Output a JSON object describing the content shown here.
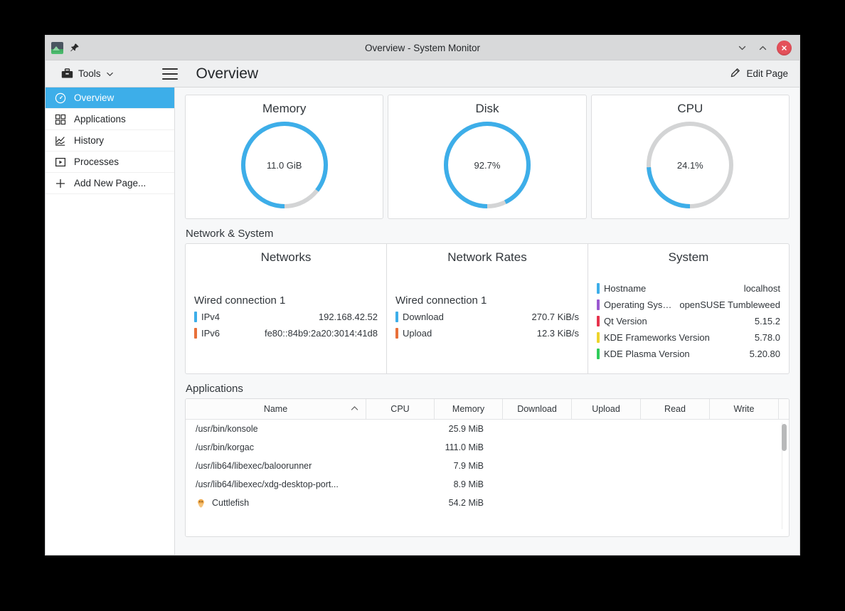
{
  "window": {
    "title": "Overview - System Monitor",
    "app_icon": "system-monitor-icon",
    "pin_icon": "pin-icon",
    "minimize_icon": "chevron-down-icon",
    "maximize_icon": "chevron-up-icon",
    "close_icon": "close-icon"
  },
  "toolbar": {
    "tools_label": "Tools",
    "tools_icon": "toolbox-icon",
    "tools_chevron": "chevron-down-icon",
    "menu_icon": "hamburger-menu-icon",
    "page_title": "Overview",
    "edit_page_label": "Edit Page",
    "edit_page_icon": "pencil-icon"
  },
  "sidebar": {
    "items": [
      {
        "label": "Overview",
        "icon": "speedometer-icon",
        "active": true
      },
      {
        "label": "Applications",
        "icon": "grid-icon",
        "active": false
      },
      {
        "label": "History",
        "icon": "line-chart-icon",
        "active": false
      },
      {
        "label": "Processes",
        "icon": "play-box-icon",
        "active": false
      },
      {
        "label": "Add New Page...",
        "icon": "plus-icon",
        "active": false
      }
    ]
  },
  "gauges": [
    {
      "title": "Memory",
      "value_label": "11.0 GiB",
      "percent": 85.5,
      "color": "#3daee9",
      "track": "#d3d4d5"
    },
    {
      "title": "Disk",
      "value_label": "92.7%",
      "percent": 92.7,
      "color": "#3daee9",
      "track": "#d3d4d5"
    },
    {
      "title": "CPU",
      "value_label": "24.1%",
      "percent": 24.1,
      "color": "#3daee9",
      "track": "#d3d4d5"
    }
  ],
  "sections": {
    "network_system_heading": "Network & System",
    "applications_heading": "Applications"
  },
  "networks": {
    "title": "Networks",
    "subtitle": "Wired connection 1",
    "rows": [
      {
        "label": "IPv4",
        "value": "192.168.42.52",
        "color": "#3daee9"
      },
      {
        "label": "IPv6",
        "value": "fe80::84b9:2a20:3014:41d8",
        "color": "#e8703a"
      }
    ]
  },
  "network_rates": {
    "title": "Network Rates",
    "subtitle": "Wired connection 1",
    "rows": [
      {
        "label": "Download",
        "value": "270.7 KiB/s",
        "color": "#3daee9"
      },
      {
        "label": "Upload",
        "value": "12.3 KiB/s",
        "color": "#e8703a"
      }
    ]
  },
  "system": {
    "title": "System",
    "rows": [
      {
        "label": "Hostname",
        "value": "localhost",
        "color": "#3daee9"
      },
      {
        "label": "Operating Syste...",
        "value": "openSUSE Tumbleweed",
        "color": "#9b59d0"
      },
      {
        "label": "Qt Version",
        "value": "5.15.2",
        "color": "#e6334d"
      },
      {
        "label": "KDE Frameworks Version",
        "value": "5.78.0",
        "color": "#edd42c"
      },
      {
        "label": "KDE Plasma Version",
        "value": "5.20.80",
        "color": "#2fcc5a"
      }
    ]
  },
  "applications_table": {
    "columns": [
      "Name",
      "CPU",
      "Memory",
      "Download",
      "Upload",
      "Read",
      "Write"
    ],
    "sort_column": "Name",
    "sort_icon": "chevron-up-icon",
    "rows": [
      {
        "name": "/usr/bin/konsole",
        "icon": null,
        "cpu": "",
        "memory": "25.9 MiB",
        "download": "",
        "upload": "",
        "read": "",
        "write": ""
      },
      {
        "name": "/usr/bin/korgac",
        "icon": null,
        "cpu": "",
        "memory": "111.0 MiB",
        "download": "",
        "upload": "",
        "read": "",
        "write": ""
      },
      {
        "name": "/usr/lib64/libexec/baloorunner",
        "icon": null,
        "cpu": "",
        "memory": "7.9 MiB",
        "download": "",
        "upload": "",
        "read": "",
        "write": ""
      },
      {
        "name": "/usr/lib64/libexec/xdg-desktop-port...",
        "icon": null,
        "cpu": "",
        "memory": "8.9 MiB",
        "download": "",
        "upload": "",
        "read": "",
        "write": ""
      },
      {
        "name": "Cuttlefish",
        "icon": "cuttlefish-app-icon",
        "cpu": "",
        "memory": "54.2 MiB",
        "download": "",
        "upload": "",
        "read": "",
        "write": ""
      }
    ]
  },
  "colors": {
    "accent": "#3daee9",
    "window_bg": "#eff0f1",
    "content_bg": "#f7f8f9",
    "close_red": "#e4505a"
  }
}
